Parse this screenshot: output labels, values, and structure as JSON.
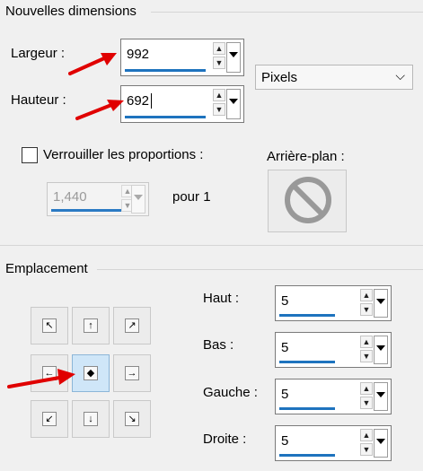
{
  "sections": {
    "new_dimensions_title": "Nouvelles dimensions",
    "placement_title": "Emplacement"
  },
  "fields": {
    "width_label": "Largeur :",
    "width_value": "992",
    "height_label": "Hauteur :",
    "height_value": "692",
    "units_selected": "Pixels",
    "lock_ratio_label": "Verrouiller les proportions :",
    "ratio_value": "1,440",
    "ratio_suffix": "pour 1",
    "background_label": "Arrière-plan :"
  },
  "placement": {
    "top_label": "Haut :",
    "top_value": "5",
    "bottom_label": "Bas :",
    "bottom_value": "5",
    "left_label": "Gauche :",
    "left_value": "5",
    "right_label": "Droite :",
    "right_value": "5"
  },
  "colors": {
    "accent": "#1e73be",
    "annotation_arrow": "#e00000",
    "active_cell": "#cfe6f8"
  }
}
